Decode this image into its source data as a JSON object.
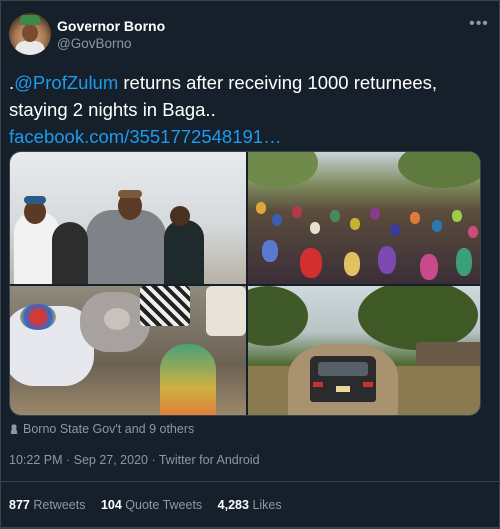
{
  "author": {
    "name": "Governor Borno",
    "handle": "@GovBorno"
  },
  "more_icon": "more-horizontal-icon",
  "tweet": {
    "prefix": ".",
    "mention": "@ProfZulum",
    "text_after_mention": " returns after receiving 1000 returnees, staying 2 nights in Baga..",
    "link": "facebook.com/3551772548191…"
  },
  "liked_by": "Borno State Gov't and 9 others",
  "timestamp": "10:22 PM · Sep 27, 2020 · Twitter for Android",
  "stats": {
    "retweets": {
      "count": "877",
      "label": "Retweets"
    },
    "quote_tweets": {
      "count": "104",
      "label": "Quote Tweets"
    },
    "likes": {
      "count": "4,283",
      "label": "Likes"
    }
  },
  "colors": {
    "background": "#15202b",
    "accent": "#1d9bf0",
    "muted": "#8899a6",
    "border": "#38444d"
  }
}
